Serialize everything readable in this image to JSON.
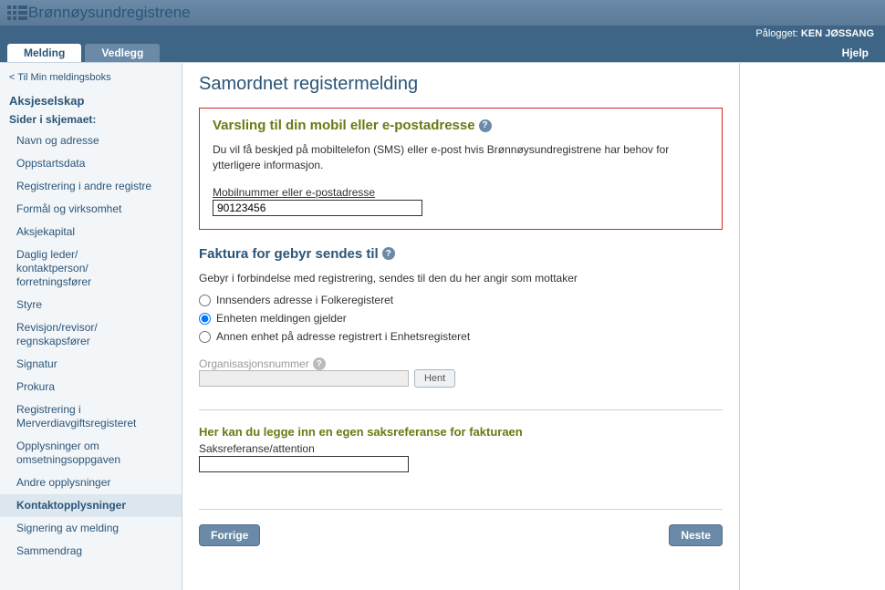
{
  "brand": "Brønnøysundregistrene",
  "login": {
    "label": "Pålogget:",
    "user": "KEN JØSSANG"
  },
  "tabs": {
    "melding": "Melding",
    "vedlegg": "Vedlegg",
    "hjelp": "Hjelp"
  },
  "sidebar": {
    "back": "< Til Min meldingsboks",
    "heading": "Aksjeselskap",
    "subheading": "Sider i skjemaet:",
    "items": [
      "Navn og adresse",
      "Oppstartsdata",
      "Registrering i andre registre",
      "Formål og virksomhet",
      "Aksjekapital",
      "Daglig leder/\nkontaktperson/\nforretningsfører",
      "Styre",
      "Revisjon/revisor/\nregnskapsfører",
      "Signatur",
      "Prokura",
      "Registrering i\nMerverdiavgiftsregisteret",
      "Opplysninger om\nomsetningsoppgaven",
      "Andre opplysninger",
      "Kontaktopplysninger",
      "Signering av melding",
      "Sammendrag"
    ],
    "active_index": 13
  },
  "page": {
    "title": "Samordnet registermelding",
    "varsling": {
      "title": "Varsling til din mobil eller e-postadresse",
      "desc": "Du vil få beskjed på mobiltelefon (SMS) eller e-post hvis Brønnøysundregistrene har behov for ytterligere informasjon.",
      "field_label": "Mobilnummer eller e-postadresse",
      "value": "90123456"
    },
    "faktura": {
      "title": "Faktura for gebyr sendes til",
      "desc": "Gebyr i forbindelse med registrering, sendes til den du her angir som mottaker",
      "options": [
        "Innsenders adresse i Folkeregisteret",
        "Enheten meldingen gjelder",
        "Annen enhet på adresse registrert i Enhetsregisteret"
      ],
      "selected_index": 1,
      "org_label": "Organisasjonsnummer",
      "hent_label": "Hent"
    },
    "ref": {
      "title": "Her kan du legge inn en egen saksreferanse for fakturaen",
      "label": "Saksreferanse/attention",
      "value": ""
    },
    "nav": {
      "prev": "Forrige",
      "next": "Neste"
    }
  }
}
